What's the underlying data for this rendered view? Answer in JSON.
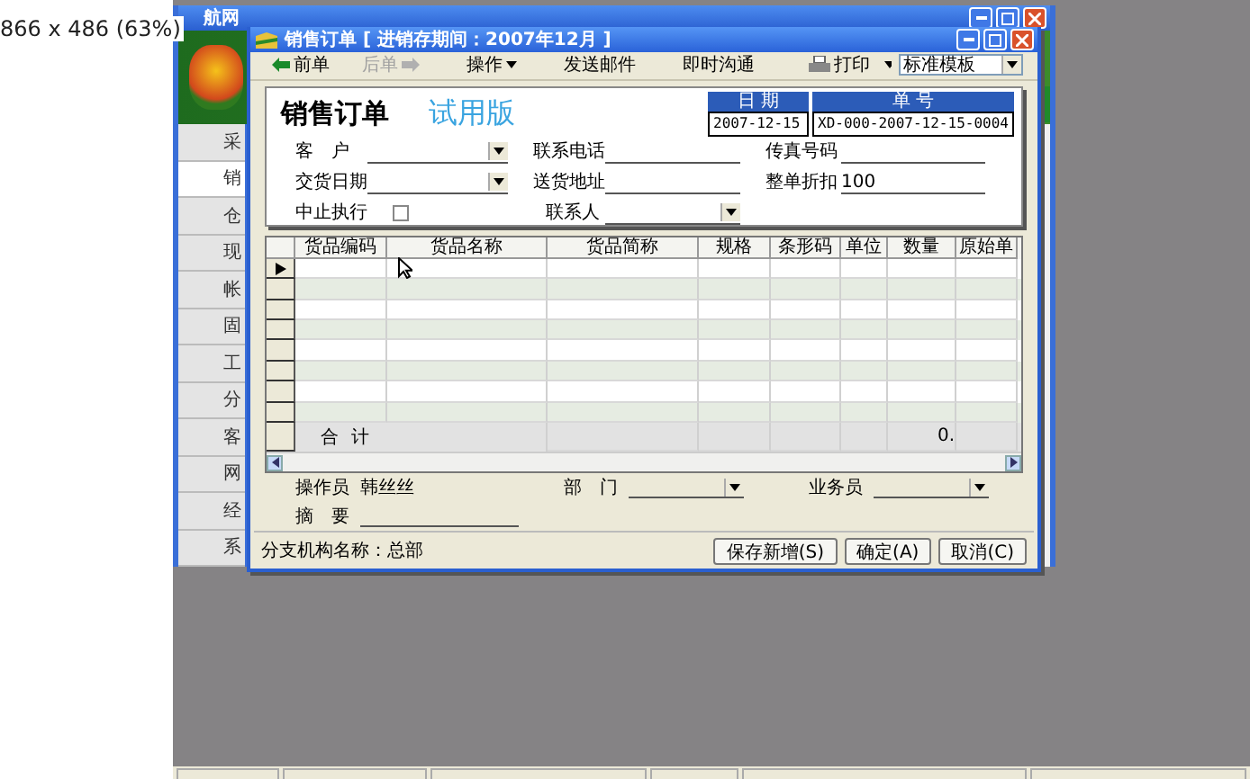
{
  "info_text": "866 x 486 (63%)",
  "background_window": {
    "title": "航网",
    "sidebar": [
      {
        "label": "采",
        "selected": false
      },
      {
        "label": "销",
        "selected": true
      },
      {
        "label": "仓",
        "selected": false
      },
      {
        "label": "现",
        "selected": false
      },
      {
        "label": "帐",
        "selected": false
      },
      {
        "label": "固",
        "selected": false
      },
      {
        "label": "工",
        "selected": false
      },
      {
        "label": "分",
        "selected": false
      },
      {
        "label": "客",
        "selected": false
      },
      {
        "label": "网",
        "selected": false
      },
      {
        "label": "经",
        "selected": false
      },
      {
        "label": "系",
        "selected": false
      }
    ]
  },
  "dialog": {
    "title": "销售订单 [ 进销存期间：2007年12月 ]",
    "toolbar": [
      {
        "label": "前单",
        "kind": "back",
        "disabled": false
      },
      {
        "label": "后单",
        "kind": "forward",
        "disabled": true
      },
      {
        "label": "操作",
        "kind": "menu",
        "disabled": false
      },
      {
        "label": "发送邮件",
        "kind": "plain",
        "disabled": false
      },
      {
        "label": "即时沟通",
        "kind": "plain",
        "disabled": false
      }
    ],
    "print": "打印",
    "template": "标准模板",
    "form_title": "销售订单",
    "edition": "试用版",
    "date_header": "日 期",
    "date": "2007-12-15",
    "number_header": "单 号",
    "number": "XD-000-2007-12-15-0004",
    "field_rows": [
      [
        {
          "label": "客　户",
          "kind": "combo"
        },
        {
          "label": "联系电话",
          "kind": "line"
        },
        {
          "label": "传真号码",
          "kind": "line"
        }
      ],
      [
        {
          "label": "交货日期",
          "kind": "combo"
        },
        {
          "label": "送货地址",
          "kind": "line"
        },
        {
          "label": "整单折扣",
          "kind": "line",
          "value": "100"
        }
      ],
      [
        {
          "label": "中止执行",
          "kind": "check",
          "checked": false
        },
        {
          "label": "联系人",
          "kind": "combo"
        }
      ]
    ],
    "columns": [
      {
        "label": "货品编码"
      },
      {
        "label": "货品名称"
      },
      {
        "label": "货品简称"
      },
      {
        "label": "规格"
      },
      {
        "label": "条形码"
      },
      {
        "label": "单位"
      },
      {
        "label": "数量",
        "total": "0."
      },
      {
        "label": "原始单"
      }
    ],
    "total_label": "合 计",
    "bottom_fields": [
      {
        "label": "操作员",
        "kind": "text",
        "value": "韩丝丝"
      },
      {
        "label": "部　门",
        "kind": "combo"
      },
      {
        "label": "业务员",
        "kind": "combo"
      },
      {
        "label": "摘　要",
        "kind": "line"
      }
    ],
    "branch": "分支机构名称：总部",
    "buttons": [
      "保存新增(S)",
      "确定(A)",
      "取消(C)"
    ]
  }
}
